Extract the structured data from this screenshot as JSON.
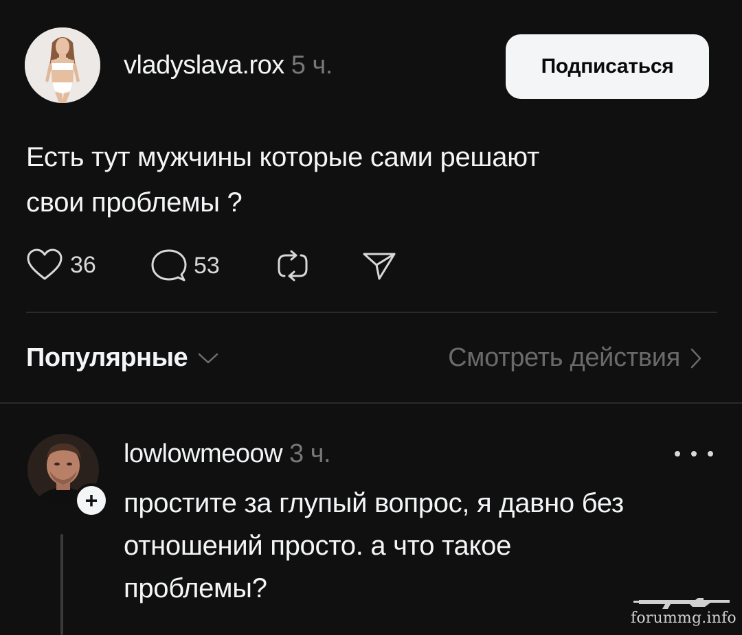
{
  "post": {
    "author": "vladyslava.rox",
    "time": "5 ч.",
    "follow_label": "Подписаться",
    "text": "Есть тут мужчины которые сами решают\nсвои проблемы ?",
    "actions": {
      "likes": "36",
      "comments": "53",
      "like_icon": "heart-icon",
      "comment_icon": "comment-bubble-icon",
      "repost_icon": "repost-icon",
      "share_icon": "send-icon"
    }
  },
  "sort": {
    "label": "Популярные",
    "view_activity": "Смотреть действия"
  },
  "reply": {
    "author": "lowlowmeoow",
    "time": "3 ч.",
    "text": "простите за глупый вопрос, я давно без\nотношений просто. а что такое\nпроблемы?",
    "follow_badge": "+"
  },
  "watermark": {
    "text": "forummg.info"
  },
  "colors": {
    "background": "#101010",
    "text": "#f3f5f7",
    "muted": "#777777",
    "button_bg": "#f3f5f7"
  }
}
